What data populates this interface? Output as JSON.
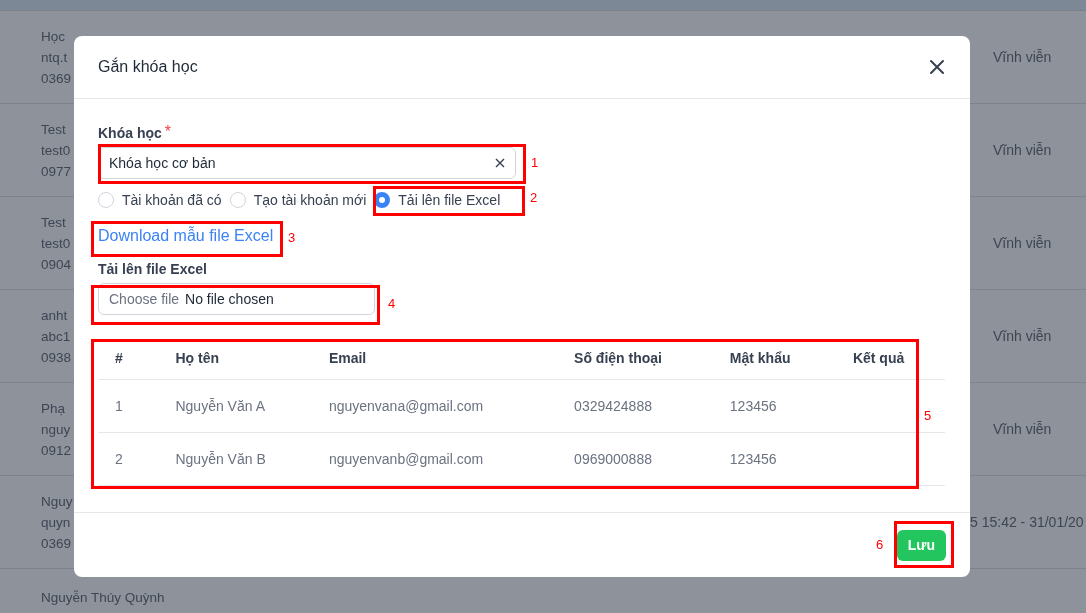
{
  "background_rows": [
    {
      "lines": [
        "Học",
        "ntq.t",
        "0369"
      ],
      "right": "Vĩnh viễn"
    },
    {
      "lines": [
        "Test",
        "test0",
        "0977"
      ],
      "right": "Vĩnh viễn"
    },
    {
      "lines": [
        "Test",
        "test0",
        "0904"
      ],
      "right": "Vĩnh viễn"
    },
    {
      "lines": [
        "anht",
        "abc1",
        "0938"
      ],
      "right": "Vĩnh viễn"
    },
    {
      "lines": [
        "Phạ",
        "nguy",
        "0912"
      ],
      "right": "Vĩnh viễn"
    },
    {
      "lines": [
        "Nguy",
        "quyn",
        "0369"
      ],
      "right": "5 15:42 - 31/01/20"
    },
    {
      "lines": [
        "Nguyễn Thúy Quỳnh"
      ]
    }
  ],
  "modal": {
    "title": "Gắn khóa học",
    "course_label": "Khóa học",
    "required_mark": "*",
    "course_value": "Khóa học cơ bản",
    "modes": [
      {
        "label": "Tài khoản đã có",
        "selected": false
      },
      {
        "label": "Tạo tài khoản mới",
        "selected": false
      },
      {
        "label": "Tải lên file Excel",
        "selected": true
      }
    ],
    "download_link": "Download mẫu file Excel",
    "upload_label": "Tải lên file Excel",
    "file_button": "Choose file",
    "file_status": "No file chosen",
    "table": {
      "columns": [
        "#",
        "Họ tên",
        "Email",
        "Số điện thoại",
        "Mật khẩu",
        "Kết quả"
      ],
      "rows": [
        [
          "1",
          "Nguyễn Văn A",
          "nguyenvana@gmail.com",
          "0329424888",
          "123456"
        ],
        [
          "2",
          "Nguyễn Văn B",
          "nguyenvanb@gmail.com",
          "0969000888",
          "123456"
        ]
      ]
    },
    "save_button": "Lưu"
  },
  "annotations": [
    "1",
    "2",
    "3",
    "4",
    "5",
    "6"
  ]
}
